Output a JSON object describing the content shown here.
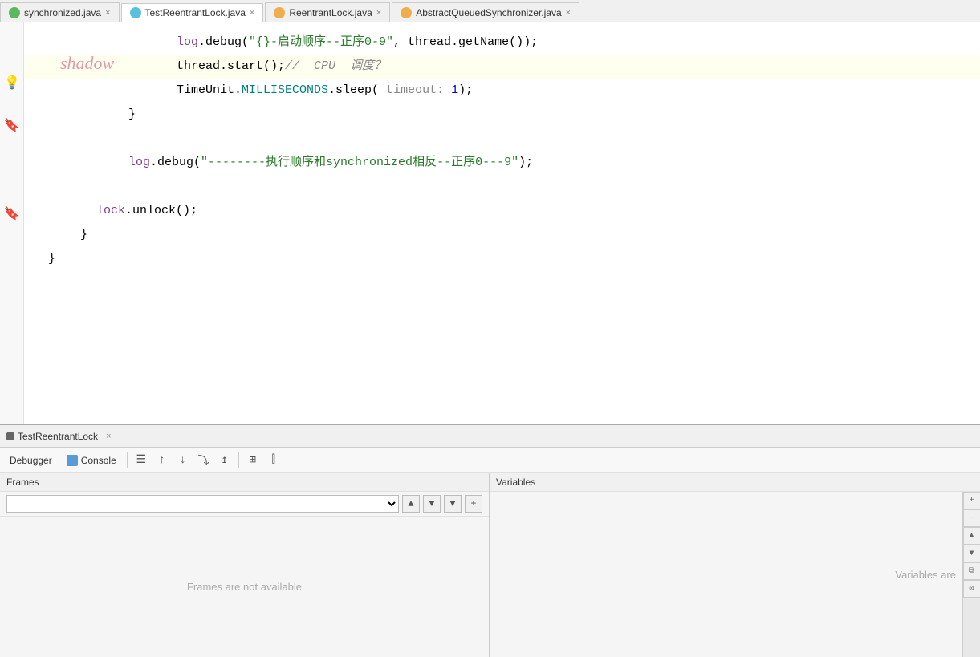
{
  "tabs": [
    {
      "id": "synchronized",
      "label": "synchronized.java",
      "active": false,
      "icon": "green",
      "closeable": true
    },
    {
      "id": "testreentrant",
      "label": "TestReentrantLock.java",
      "active": true,
      "icon": "blue",
      "closeable": true
    },
    {
      "id": "reentrant",
      "label": "ReentrantLock.java",
      "active": false,
      "icon": "orange",
      "closeable": true
    },
    {
      "id": "abstractqueue",
      "label": "AbstractQueuedSynchronizer.java",
      "active": false,
      "icon": "orange",
      "closeable": true
    }
  ],
  "watermark": "shadow",
  "code_lines": [
    {
      "id": 1,
      "indent": 12,
      "content": "log.debug(\"{}-启动顺序--正序0-9\", thread.getName());",
      "highlight": false
    },
    {
      "id": 2,
      "indent": 12,
      "content": "thread.start();//  CPU  调度？",
      "highlight": true
    },
    {
      "id": 3,
      "indent": 12,
      "content": "TimeUnit.MILLISECONDS.sleep( timeout: 1);",
      "highlight": false
    },
    {
      "id": 4,
      "indent": 8,
      "content": "}",
      "highlight": false
    },
    {
      "id": 5,
      "indent": 0,
      "content": "",
      "highlight": false
    },
    {
      "id": 6,
      "indent": 8,
      "content": "log.debug(\"--------执行顺序和synchronized相反--正序0---9\");",
      "highlight": false
    },
    {
      "id": 7,
      "indent": 0,
      "content": "",
      "highlight": false
    },
    {
      "id": 8,
      "indent": 6,
      "content": "lock.unlock();",
      "highlight": false
    },
    {
      "id": 9,
      "indent": 4,
      "content": "}",
      "highlight": false
    },
    {
      "id": 10,
      "indent": 0,
      "content": "}",
      "highlight": false
    }
  ],
  "debug_session": {
    "run_name": "TestReentrantLock",
    "tabs": [
      {
        "id": "debugger",
        "label": "Debugger",
        "active": true
      },
      {
        "id": "console",
        "label": "Console",
        "active": false
      }
    ],
    "toolbar_icons": [
      "menu",
      "step-over-up",
      "step-over-down",
      "step-over-right",
      "step-out",
      "table",
      "columns"
    ],
    "frames_label": "Frames",
    "variables_label": "Variables",
    "frames_empty_text": "Frames are not available",
    "variables_empty_text": "Variables are"
  }
}
